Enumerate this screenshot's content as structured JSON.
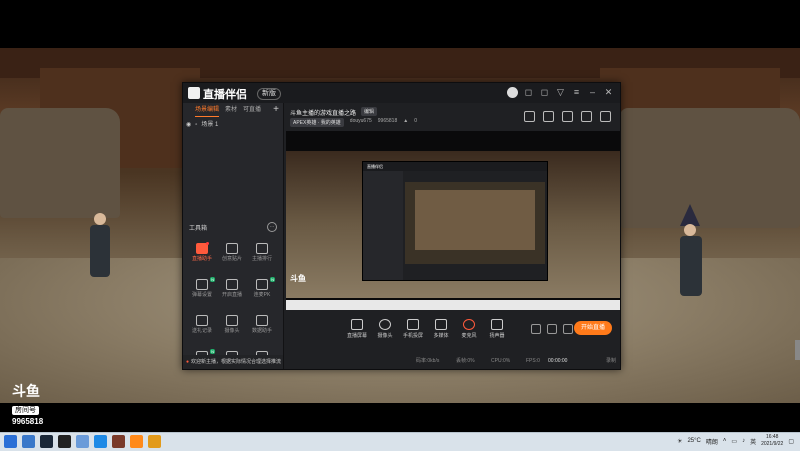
{
  "app": {
    "title": "直播伴侣",
    "version_badge": "新版",
    "sidebar": {
      "tabs": [
        "场景编辑",
        "素材",
        "可直播"
      ],
      "scene_name": "场景 1",
      "toolbox_title": "工具箱",
      "tools": [
        {
          "label": "直播助手",
          "active": true,
          "dot": true
        },
        {
          "label": "创意贴片"
        },
        {
          "label": "主播排行"
        },
        {
          "label": "弹幕设置",
          "new": true
        },
        {
          "label": "开启直播"
        },
        {
          "label": "连麦PK",
          "new": true
        },
        {
          "label": "送礼记录"
        },
        {
          "label": "摄像头"
        },
        {
          "label": "数据助手"
        },
        {
          "label": "连线PK",
          "new": true
        },
        {
          "label": "下载"
        },
        {
          "label": "云手机"
        }
      ],
      "notice": "欢迎新主播，根据实际情况合理选择推流"
    },
    "stream": {
      "title": "斗鱼主播的游戏直播之路",
      "edit_badge": "编辑",
      "category": "APEX英雄 · 我的英雄",
      "uid": "douyu675",
      "room_id": "9965818",
      "heat": "0"
    },
    "controls": [
      {
        "label": "直播屏幕",
        "icon": "monitor-icon"
      },
      {
        "label": "摄像头",
        "icon": "camera-icon"
      },
      {
        "label": "手机投屏",
        "icon": "phone-cast-icon"
      },
      {
        "label": "多媒体",
        "icon": "media-icon"
      },
      {
        "label": "麦克风",
        "icon": "mic-icon"
      },
      {
        "label": "扬声器",
        "icon": "speaker-icon"
      }
    ],
    "start_button": "开始直播",
    "status": {
      "item1": "码率:0kb/s",
      "item2": "丢帧:0%",
      "item3": "CPU:0%",
      "item4": "FPS:0",
      "rec_time": "00:00:00",
      "rec_label": "录制"
    }
  },
  "watermark": {
    "brand": "斗鱼",
    "room_label": "房间号",
    "room_number": "9965818"
  },
  "taskbar": {
    "weather": "25°C",
    "weather_desc": "晴朗",
    "lang": "英",
    "time": "16:48",
    "date": "2021/9/22"
  }
}
